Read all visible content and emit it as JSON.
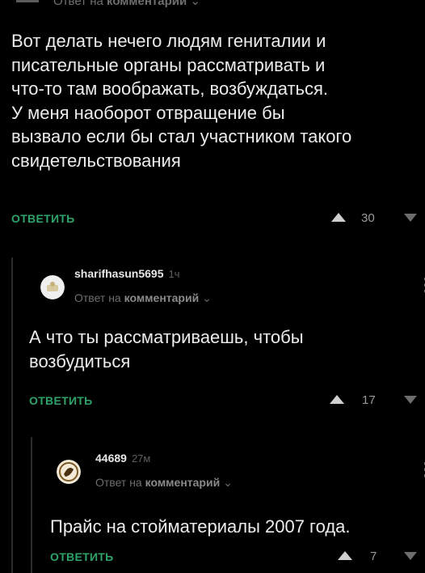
{
  "top": {
    "reply_prefix": "Ответ на",
    "reply_target": "комментарий"
  },
  "comments": [
    {
      "text_lines": [
        "Вот делать нечего людям гениталии и",
        "писательные органы рассматривать и",
        "что-то там воображать, возбуждаться.",
        "У меня наоборот отвращение бы",
        "вызвало если бы стал участником такого",
        "свидетельствования"
      ],
      "reply_label": "ОТВЕТИТЬ",
      "score": "30"
    },
    {
      "username": "sharifhasun5695",
      "time": "1ч",
      "reply_prefix": "Ответ на",
      "reply_target": "комментарий",
      "text_lines": [
        "А что ты рассматриваешь, чтобы",
        "возбудиться"
      ],
      "reply_label": "ОТВЕТИТЬ",
      "score": "17"
    },
    {
      "username": "44689",
      "time": "27м",
      "reply_prefix": "Ответ на",
      "reply_target": "комментарий",
      "text_lines": [
        "Прайс на стойматериалы 2007 года."
      ],
      "reply_label": "ОТВЕТИТЬ",
      "score": "7"
    }
  ],
  "colors": {
    "background": "#000000",
    "accent_reply": "#2ea36a",
    "text": "#ececec",
    "muted": "#6e6e6e"
  },
  "icons": {
    "upvote": "triangle-up-icon",
    "downvote": "triangle-down-icon",
    "more": "vertical-dots-icon",
    "chevron": "chevron-down-icon"
  }
}
